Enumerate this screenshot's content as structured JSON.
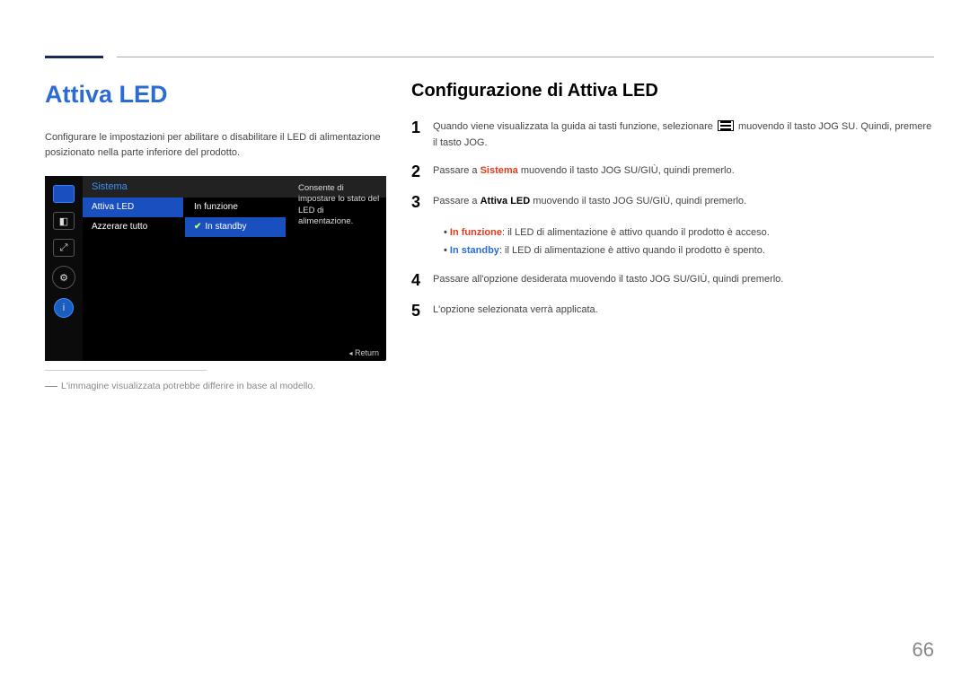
{
  "title": "Attiva LED",
  "intro": "Configurare le impostazioni per abilitare o disabilitare il LED di alimentazione posizionato nella parte inferiore del prodotto.",
  "osd": {
    "category": "Sistema",
    "menu_items": [
      "Attiva LED",
      "Azzerare tutto"
    ],
    "value_items": [
      "In funzione",
      "In standby"
    ],
    "value_selected_index": 1,
    "description": "Consente di impostare lo stato del LED di alimentazione.",
    "footer": "Return"
  },
  "left_note": "L'immagine visualizzata potrebbe differire in base al modello.",
  "subtitle": "Configurazione di Attiva LED",
  "steps": {
    "s1a": "Quando viene visualizzata la guida ai tasti funzione, selezionare ",
    "s1b": " muovendo il tasto JOG SU. Quindi, premere il tasto JOG.",
    "s2a": "Passare a ",
    "s2b": "Sistema",
    "s2c": " muovendo il tasto JOG SU/GIÙ, quindi premerlo.",
    "s3a": "Passare a ",
    "s3b": "Attiva LED",
    "s3c": " muovendo il tasto JOG SU/GIÙ, quindi premerlo.",
    "b1a": "In funzione",
    "b1b": ": il LED di alimentazione è attivo quando il prodotto è acceso.",
    "b2a": "In standby",
    "b2b": ": il LED di alimentazione è attivo quando il prodotto è spento.",
    "s4": "Passare all'opzione desiderata muovendo il tasto JOG SU/GIÙ, quindi premerlo.",
    "s5": "L'opzione selezionata verrà applicata."
  },
  "page_number": "66"
}
